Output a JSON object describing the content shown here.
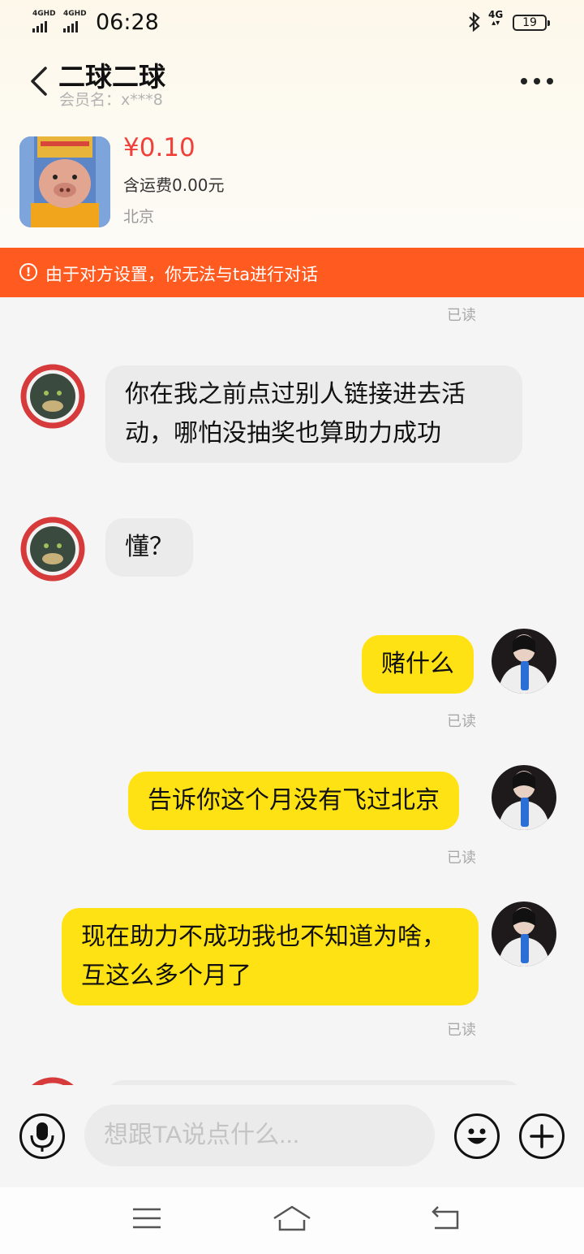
{
  "status_bar": {
    "signal1_label": "4GHD",
    "signal2_label": "4GHD",
    "time": "06:28",
    "bluetooth_icon": "bluetooth-icon",
    "network_label": "4G",
    "battery_level": "19"
  },
  "header": {
    "title": "二球二球",
    "member_name": "会员名：x***8",
    "back_icon": "chevron-left-icon",
    "more_icon": "more-dots-icon"
  },
  "product": {
    "price": "¥0.10",
    "shipping": "含运费0.00元",
    "location": "北京"
  },
  "warning": {
    "text": "由于对方设置，你无法与ta进行对话",
    "icon": "!",
    "color": "#ff5a1f"
  },
  "messages": {
    "read_top": "已读",
    "m1": "你在我之前点过别人链接进去活动，哪怕没抽奖也算助力成功",
    "m2": "懂？",
    "m3": "赌什么",
    "m3_status": "已读",
    "m4": "告诉你这个月没有飞过北京",
    "m4_status": "已读",
    "m5": "现在助力不成功我也不知道为啥，互这么多个月了",
    "m5_status": "已读"
  },
  "input": {
    "placeholder": "想跟TA说点什么..."
  },
  "colors": {
    "outgoing_bubble": "#ffe213",
    "incoming_bubble": "#ebebeb",
    "price": "#f0403a"
  }
}
